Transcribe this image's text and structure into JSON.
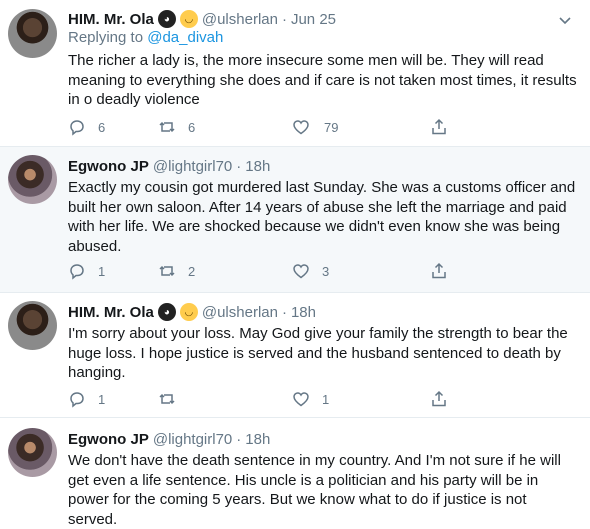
{
  "tweets": [
    {
      "name": "HIM. Mr. Ola",
      "emoji1": "ninja-emoji",
      "emoji2": "mask-emoji",
      "handle": "@ulsherlan",
      "dot": "·",
      "time": "Jun 25",
      "reply_prefix": "Replying to",
      "reply_to": "@da_divah",
      "text": "The richer a lady is, the more insecure some men will be. They will read meaning to everything she does and if care is not taken most times, it results in o deadly violence",
      "replies": "6",
      "retweets": "6",
      "likes": "79"
    },
    {
      "name": "Egwono JP",
      "handle": "@lightgirl70",
      "dot": "·",
      "time": "18h",
      "text": "Exactly my cousin got murdered last Sunday. She was a customs officer and built her own saloon. After 14 years of abuse she left the marriage and paid with her life. We are shocked because we didn't even know she was being abused.",
      "replies": "1",
      "retweets": "2",
      "likes": "3"
    },
    {
      "name": "HIM. Mr. Ola",
      "emoji1": "ninja-emoji",
      "emoji2": "mask-emoji",
      "handle": "@ulsherlan",
      "dot": "·",
      "time": "18h",
      "text": "I'm sorry about your loss. May God give your family the strength to bear the huge loss. I hope justice is served and the husband sentenced to death by hanging.",
      "replies": "1",
      "retweets": "",
      "likes": "1"
    },
    {
      "name": "Egwono JP",
      "handle": "@lightgirl70",
      "dot": "·",
      "time": "18h",
      "text": "We don't have the death sentence in my country. And I'm not sure if he will get even a life sentence. His uncle is a politician and his party will be in power for the coming 5 years. But we know what to do if justice is not served."
    }
  ],
  "colors": {
    "accent": "#1b95e0",
    "muted": "#657786",
    "highlight_bg": "#f5f8fa"
  }
}
